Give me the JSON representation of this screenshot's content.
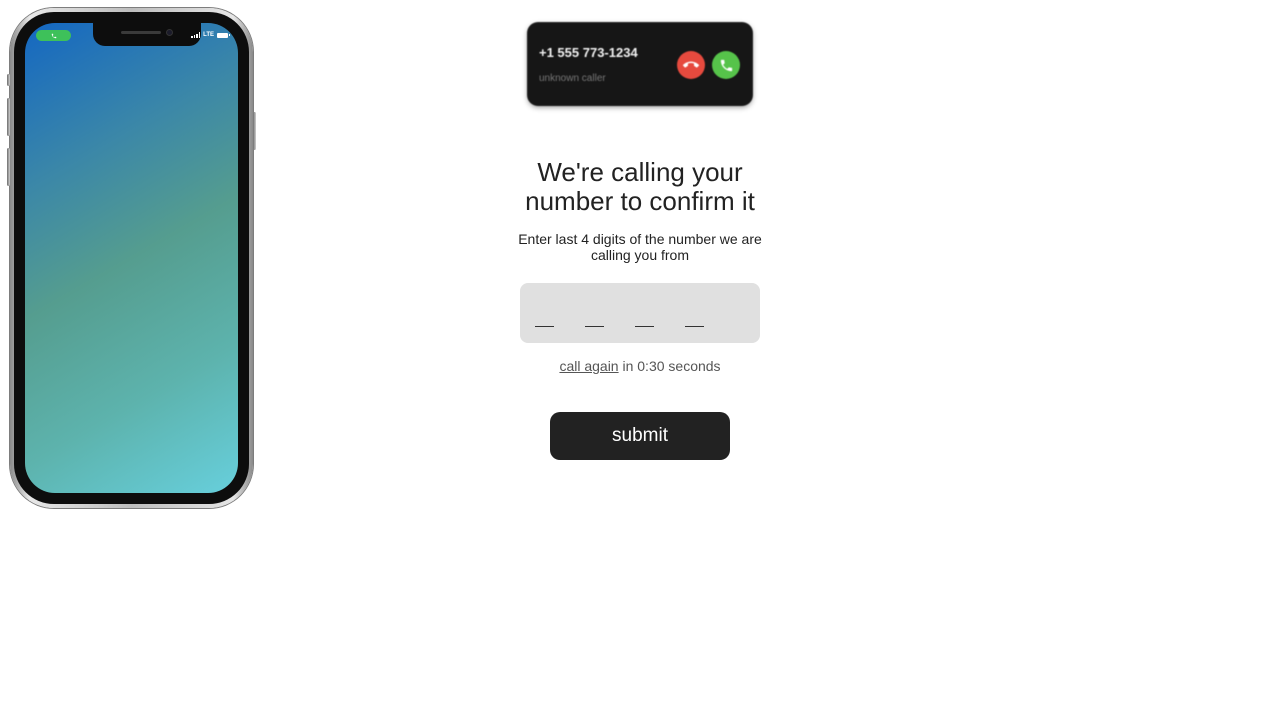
{
  "phone": {
    "status_bar": {
      "call_indicator_icon": "phone-icon",
      "network_label": "LTE",
      "signal_icon": "signal-bars-icon",
      "battery_icon": "battery-icon"
    },
    "screen_gradient": [
      "#1467c2",
      "#559d8f",
      "#67cfdc"
    ]
  },
  "incoming_call": {
    "number": "+1 555 773-1234",
    "caller_label": "unknown caller",
    "decline_icon": "decline-call-icon",
    "accept_icon": "accept-call-icon",
    "colors": {
      "decline": "#e64a3e",
      "accept": "#56c34a"
    }
  },
  "form": {
    "title": "We're calling your number to confirm it",
    "subtitle": "Enter last 4 digits of the number we are calling you from",
    "digits": [
      "",
      "",
      "",
      ""
    ],
    "call_again_link": "call again",
    "countdown_text": "in 0:30 seconds",
    "submit_label": "submit"
  },
  "colors": {
    "button_bg": "#222222",
    "code_box_bg": "#e0e0e0"
  }
}
